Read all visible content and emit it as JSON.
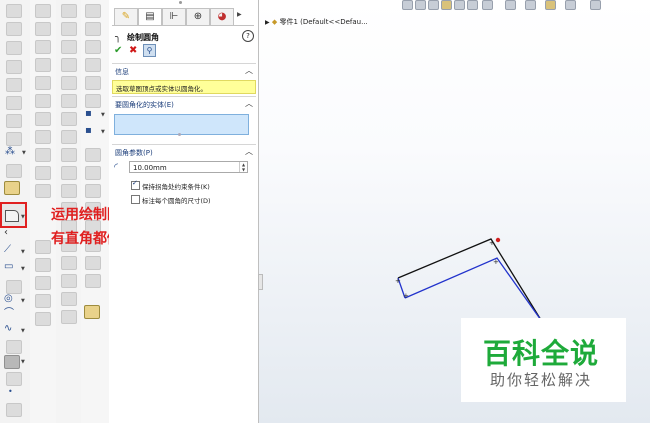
{
  "property_manager": {
    "title": "绘制圆角",
    "help_icon": "?",
    "message_section": {
      "title": "信息",
      "text": "选取草图顶点或实体以圆角化。"
    },
    "entities_section": {
      "title": "要圆角化的实体(E)"
    },
    "params_section": {
      "title": "圆角参数(P)",
      "radius_value": "10.00mm",
      "keep_constrained_corners_label": "保持拐角处约束条件(K)",
      "keep_constrained_corners_checked": true,
      "dimension_each_label": "标注每个圆角的尺寸(D)",
      "dimension_each_checked": false
    }
  },
  "feature_tree": {
    "root_label": "零件1 (Default<<Defau..."
  },
  "annotation": {
    "line1": "运用绘制圆角功能将所",
    "line2": "有直角都倒圆",
    "color": "#e02020"
  },
  "watermark": {
    "title": "百科全说",
    "subtitle": "助你轻松解决",
    "color": "#1eaa3a"
  },
  "sketch": {
    "black_line_color": "#111111",
    "blue_line_color": "#2233cc"
  },
  "colors": {
    "info_bg": "#ffff99",
    "list_bg": "#cfe6fb",
    "accent_red": "#e02020"
  }
}
